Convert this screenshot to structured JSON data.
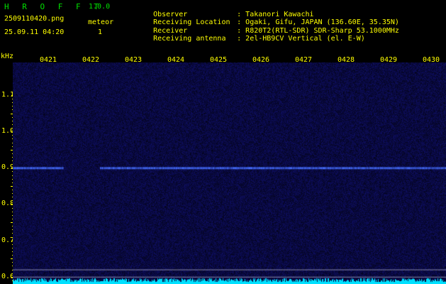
{
  "header": {
    "logo": "H R O F F T",
    "version": "1.0.0",
    "filename": "2509110420.png",
    "timestamp": "25.09.11 04:20",
    "meteor_label": "meteor",
    "meteor_count": "1"
  },
  "info": [
    {
      "label": "Observer",
      "value": "Takanori Kawachi"
    },
    {
      "label": "Receiving Location",
      "value": "Ogaki, Gifu, JAPAN (136.60E, 35.35N)"
    },
    {
      "label": "Receiver",
      "value": "R820T2(RTL-SDR) SDR-Sharp 53.1000MHz"
    },
    {
      "label": "Receiving antenna",
      "value": "2el-HB9CV Vertical (el. E-W)"
    }
  ],
  "spectrogram": {
    "y_unit": "kHz",
    "y_ticks": [
      "1.1",
      "1.0",
      "0.9",
      "0.8",
      "0.7",
      "0.6"
    ],
    "y_tick_values": [
      1.1,
      1.0,
      0.9,
      0.8,
      0.7,
      0.6
    ],
    "ylim": [
      0.58,
      1.19
    ],
    "x_ticks": [
      "0421",
      "0422",
      "0423",
      "0424",
      "0425",
      "0426",
      "0427",
      "0428",
      "0429",
      "0430"
    ],
    "carrier_khz": 0.9,
    "guide_lines_khz": [
      0.62,
      0.6
    ],
    "carrier_gap_minutes": [
      "0421.5",
      "0422.2"
    ],
    "colors": {
      "background": "#000000",
      "noise": "#1a1a6e",
      "carrier": "#3b5cff",
      "text": "#ffff00",
      "logo": "#00e000",
      "power": "#00e0ff"
    }
  }
}
